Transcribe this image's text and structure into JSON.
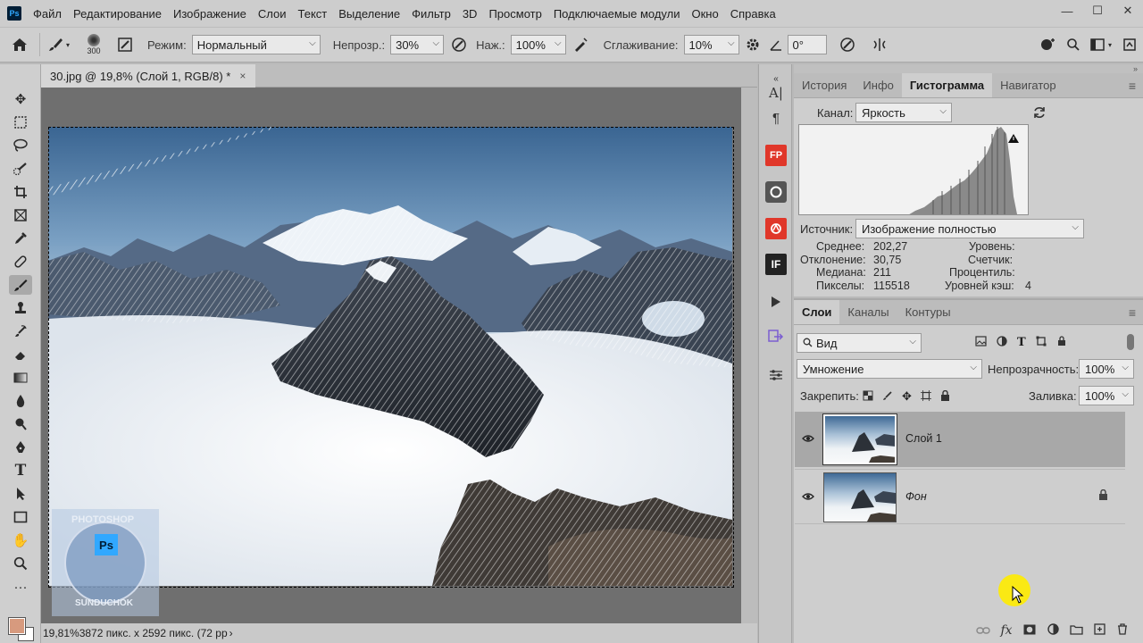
{
  "app": {
    "logo": "Ps"
  },
  "menu": [
    "Файл",
    "Редактирование",
    "Изображение",
    "Слои",
    "Текст",
    "Выделение",
    "Фильтр",
    "3D",
    "Просмотр",
    "Подключаемые модули",
    "Окно",
    "Справка"
  ],
  "window_controls": {
    "minimize": "—",
    "maximize": "☐",
    "close": "✕"
  },
  "options": {
    "brush_size": "300",
    "mode_label": "Режим:",
    "mode_value": "Нормальный",
    "opacity_label": "Непрозр.:",
    "opacity_value": "30%",
    "pressure_label": "Наж.:",
    "pressure_value": "100%",
    "smoothing_label": "Сглаживание:",
    "smoothing_value": "10%",
    "angle_value": "0°"
  },
  "document": {
    "tab_title": "30.jpg @ 19,8% (Слой 1, RGB/8) *",
    "close": "×",
    "status_zoom": "19,81%",
    "status_info": "3872 пикс. x 2592 пикс. (72 pp"
  },
  "watermark": {
    "top_text": "PHOTOSHOP",
    "badge": "Ps",
    "bottom_text": "SUNDUCHOK"
  },
  "dock": {
    "char": "A|",
    "para": "¶",
    "fp": "FP",
    "plugin3": "IF"
  },
  "histogram_panel": {
    "tabs": [
      "История",
      "Инфо",
      "Гистограмма",
      "Навигатор"
    ],
    "active_tab": 2,
    "channel_label": "Канал:",
    "channel_value": "Яркость",
    "source_label": "Источник:",
    "source_value": "Изображение полностью",
    "stats": {
      "mean_label": "Среднее:",
      "mean": "202,27",
      "dev_label": "Отклонение:",
      "dev": "30,75",
      "median_label": "Медиана:",
      "median": "211",
      "pixels_label": "Пикселы:",
      "pixels": "115518",
      "level_label": "Уровень:",
      "count_label": "Счетчик:",
      "percentile_label": "Процентиль:",
      "cache_label": "Уровней кэш:",
      "cache": "4"
    }
  },
  "layers_panel": {
    "tabs": [
      "Слои",
      "Каналы",
      "Контуры"
    ],
    "active_tab": 0,
    "filter_value": "Вид",
    "blend_mode": "Умножение",
    "opacity_label": "Непрозрачность:",
    "opacity_value": "100%",
    "lock_label": "Закрепить:",
    "fill_label": "Заливка:",
    "fill_value": "100%",
    "layers": [
      {
        "name": "Слой 1",
        "selected": true,
        "locked": false
      },
      {
        "name": "Фон",
        "selected": false,
        "locked": true
      }
    ]
  },
  "colors": {
    "foreground": "#d79a7e",
    "background": "#ffffff",
    "accent": "#31a8ff"
  }
}
